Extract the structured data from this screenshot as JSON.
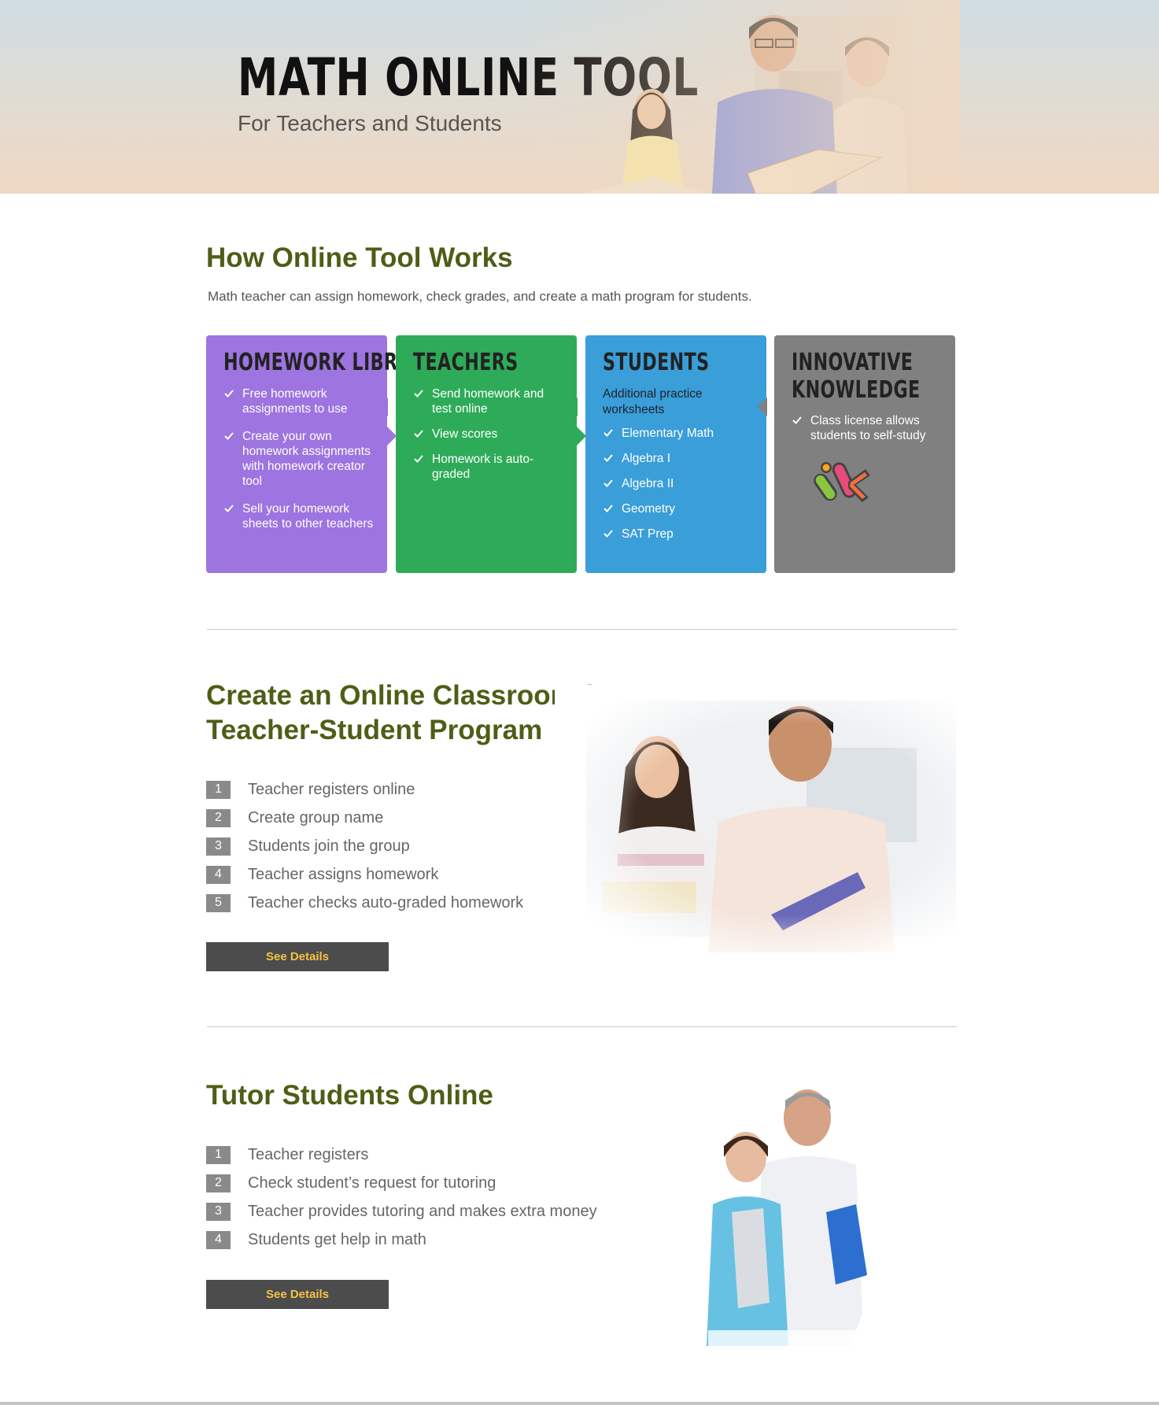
{
  "hero": {
    "title": "MATH ONLINE TOOL",
    "subtitle": "For Teachers and Students"
  },
  "how_it_works": {
    "title": "How Online Tool Works",
    "intro": "Math teacher can assign homework, check grades, and create a math program for students.",
    "cards": [
      {
        "title": "HOMEWORK LIBRARY",
        "color": "#9d74e0",
        "items": [
          "Free homework assignments to use",
          "Create your own homework assignments with homework creator tool",
          "Sell your homework sheets to other teachers"
        ]
      },
      {
        "title": "TEACHERS",
        "color": "#2eab58",
        "items": [
          "Send homework and test online",
          "View scores",
          "Homework is auto-graded"
        ]
      },
      {
        "title": "STUDENTS",
        "color": "#3a9ed8",
        "note": "Additional practice worksheets",
        "items": [
          "Elementary Math",
          "Algebra I",
          "Algebra II",
          "Geometry",
          "SAT Prep"
        ]
      },
      {
        "title_line1": "INNOVATIVE",
        "title_line2": "KNOWLEDGE",
        "color": "#808080",
        "items": [
          "Class license allows students to self-study"
        ],
        "logo_icon": "ik-logo-icon"
      }
    ]
  },
  "classroom": {
    "title_line1": "Create an Online Classroom for",
    "title_line2": "Teacher-Student Program",
    "steps": [
      {
        "num": "1",
        "text": "Teacher registers online"
      },
      {
        "num": "2",
        "text": "Create group name"
      },
      {
        "num": "3",
        "text": "Students join the group"
      },
      {
        "num": "4",
        "text": "Teacher assigns homework"
      },
      {
        "num": "5",
        "text": "Teacher checks auto-graded homework"
      }
    ],
    "button": "See Details"
  },
  "tutor": {
    "title": "Tutor Students Online",
    "steps": [
      {
        "num": "1",
        "text": "Teacher registers"
      },
      {
        "num": "2",
        "text": "Check student’s request for tutoring"
      },
      {
        "num": "3",
        "text": "Teacher provides tutoring and makes extra money"
      },
      {
        "num": "4",
        "text": "Students get help in math"
      }
    ],
    "button": "See Details"
  },
  "colors": {
    "heading_green": "#4d5e16",
    "button_bg": "#4c4c4c",
    "button_text": "#f5c242"
  }
}
